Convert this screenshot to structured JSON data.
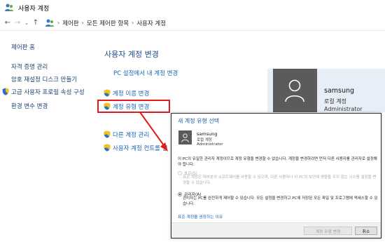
{
  "window": {
    "title": "사용자 계정",
    "icon": "users-icon"
  },
  "address_bar": {
    "crumbs": [
      "제어판",
      "모든 제어판 항목",
      "사용자 계정"
    ],
    "separator": "›"
  },
  "left_nav": {
    "items": [
      {
        "label": "제어판 홈"
      },
      {
        "label": "자격 증명 관리"
      },
      {
        "label": "암호 재설정 디스크 만들기"
      },
      {
        "label": "고급 사용자 프로필 속성 구성",
        "icon": "shield-icon"
      },
      {
        "label": "환경 변수 변경"
      }
    ]
  },
  "main": {
    "title": "사용자 계정 변경",
    "links": [
      {
        "label": "PC 설정에서 내 계정 변경"
      },
      {
        "label": "계정 이름 변경",
        "icon": "shield-icon"
      },
      {
        "label": "계정 유형 변경",
        "icon": "shield-icon"
      },
      {
        "label": "다른 계정 관리",
        "icon": "shield-icon"
      },
      {
        "label": "사용자 계정 컨트롤 설",
        "icon": "shield-icon"
      }
    ]
  },
  "account": {
    "name": "samsung",
    "type": "로컬 계정",
    "role": "Administrator"
  },
  "dialog": {
    "title": "새 계정 유형 선택",
    "account": {
      "name": "samsung",
      "type": "로컬 계정",
      "role": "Administrator"
    },
    "description": "이 PC의 유일한 관리자 계정이므로 계정 유형을 변경할 수 없습니다. 계정을 변경하려면 먼저 다른 사용자를 관리자로 설정해야 합니다.",
    "options": [
      {
        "label": "표준(S)",
        "description": "표준 계정은 대부분의 소프트웨어를 사용할 수 있으며, 다른 사용자나 이 PC의 보안에 영향을 주지 않는 시스템 설정을 변경할 수 있습니다.",
        "selected": false,
        "disabled": true
      },
      {
        "label": "관리자(A)",
        "description": "관리자는 PC를 완전하게 제어할 수 있습니다. 모든 설정을 변경하고 PC에 저장된 모든 파일 및 프로그램에 액세스할 수 있습니다.",
        "selected": true,
        "disabled": false
      }
    ],
    "help_link": "표준 계정을 권장하는 이유",
    "buttons": {
      "change": "계정 유형 변경",
      "cancel": "취소"
    }
  },
  "colors": {
    "link": "#1764b3",
    "highlight": "#e11b1b",
    "heading": "#1e4e8c",
    "avatar": "#5b5b5b"
  }
}
